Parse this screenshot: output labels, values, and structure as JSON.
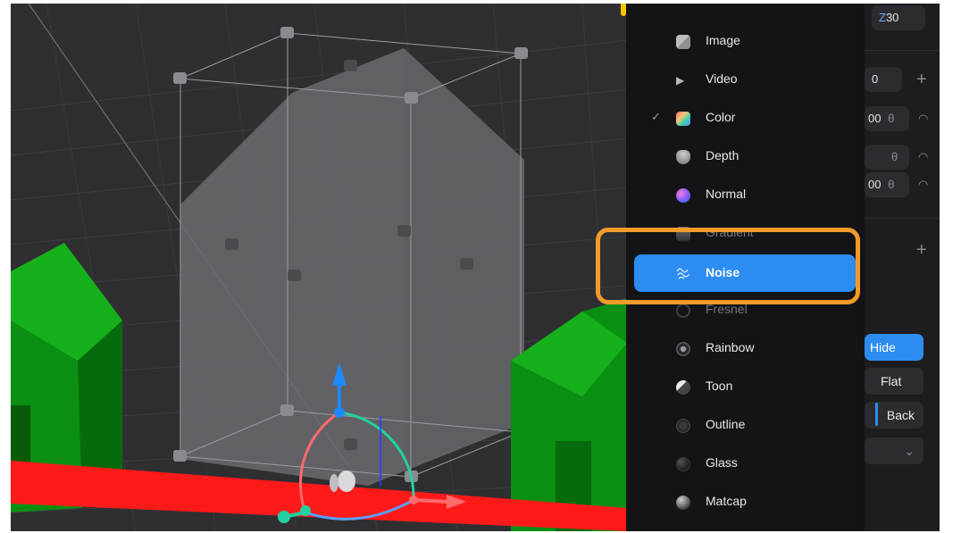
{
  "menu": {
    "items": [
      {
        "label": "Image",
        "icon": "image-icon",
        "checked": false,
        "selected": false
      },
      {
        "label": "Video",
        "icon": "video-play-icon",
        "checked": false,
        "selected": false
      },
      {
        "label": "Color",
        "icon": "color-swatch-icon",
        "checked": true,
        "selected": false
      },
      {
        "label": "Depth",
        "icon": "depth-icon",
        "checked": false,
        "selected": false
      },
      {
        "label": "Normal",
        "icon": "normal-sphere-icon",
        "checked": false,
        "selected": false
      },
      {
        "label": "Gradient",
        "icon": "gradient-icon",
        "checked": false,
        "selected": false
      },
      {
        "label": "Noise",
        "icon": "noise-icon",
        "checked": false,
        "selected": true
      },
      {
        "label": "Fresnel",
        "icon": "fresnel-icon",
        "checked": false,
        "selected": false
      },
      {
        "label": "Rainbow",
        "icon": "rainbow-icon",
        "checked": false,
        "selected": false
      },
      {
        "label": "Toon",
        "icon": "toon-icon",
        "checked": false,
        "selected": false
      },
      {
        "label": "Outline",
        "icon": "outline-icon",
        "checked": false,
        "selected": false
      },
      {
        "label": "Glass",
        "icon": "glass-icon",
        "checked": false,
        "selected": false
      },
      {
        "label": "Matcap",
        "icon": "matcap-icon",
        "checked": false,
        "selected": false
      }
    ],
    "check_glyph": "✓"
  },
  "properties": {
    "z_axis": "Z",
    "z_value": "30",
    "field_1": "0",
    "field_2": "00",
    "field_3": "",
    "field_4": "00",
    "lock_glyph": "θ",
    "eye_glyph": "◠",
    "plus_glyph": "+",
    "hide_label": "Hide",
    "flat_label": "Flat",
    "back_label": "Back",
    "dropdown_caret": "⌄"
  },
  "colors": {
    "accent": "#2d8cf0",
    "highlight": "#f39a2b",
    "house_green": "#10a010",
    "ground_red": "#ff1a1a",
    "axis_blue": "#1e88ff",
    "axis_red": "#ff5a5a",
    "axis_green": "#21d19f"
  }
}
